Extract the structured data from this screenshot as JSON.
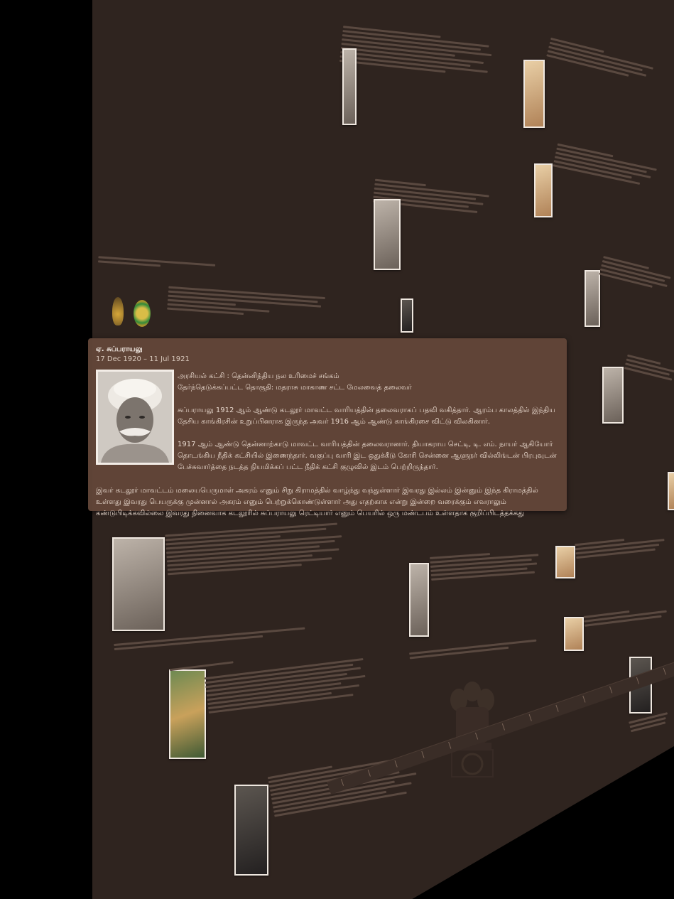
{
  "popup": {
    "name": "ஏ. சுப்பராயலு",
    "dates": "17 Dec 1920 – 11 Jul 1921",
    "party": "அரசியல் கட்சி : தென்னிந்திய நல உரிமைச் சங்கம்",
    "constituency": "தேர்ந்தெடுக்கப்பட்ட தொகுதி: மதராசு மாகாண சட்ட மேலவைத் தலைவர்",
    "para1": "சுப்பராயலு 1912 ஆம் ஆண்டு கடலூர் மாவட்ட வாரியத்தின் தலைவராகப் பதவி வகித்தார். ஆரம்ப காலத்தில் இந்திய தேசிய காங்கிரசின் உறுப்பினராக இருந்த அவர் 1916 ஆம் ஆண்டு காங்கிரசை விட்டு விலகினார்.",
    "para2": "1917 ஆம் ஆண்டு தென்னாற்காடு மாவட்ட வாரியத்தின் தலைவரானார். தியாகராய செட்டி, டி. எம். நாயர் ஆகியோர் தொடங்கிய நீதிக் கட்சியில் இணைந்தார். வகுப்பு வாரி இட ஒதுக்கீடு கோரி சென்னை ஆளுநர் வில்லிங்டன் பிரபுவுடன் பேச்சுவார்த்தை நடத்த நியமிக்கப் பட்ட நீதிக் கட்சி குழுவில் இடம் பெற்றிருந்தார்.",
    "footer": "இவர் கடலூர் மாவட்டம் மலையபெருமாள் அகரம் எனும் சிறு கிராமத்தில் வாழ்ந்து வந்துள்ளார் இவரது இல்லம் இன்னும் இந்த கிராமத்தில் உள்ளது இவரது பெயருக்கு முன்னால் அகரம் எனும் பெற்றுக்கொண்டுள்ளார் அது எதற்காக என்று இன்றை வரைக்கும் எவராலும் கண்டுபிடிக்கவில்லை இவரது நினைவாக கடலூரில் சுப்பராயலு ரெட்டியார் எனும் பெயரில் ஒரு மண்டபம் உள்ளதாக குறிப்பிடத்தக்கது"
  }
}
